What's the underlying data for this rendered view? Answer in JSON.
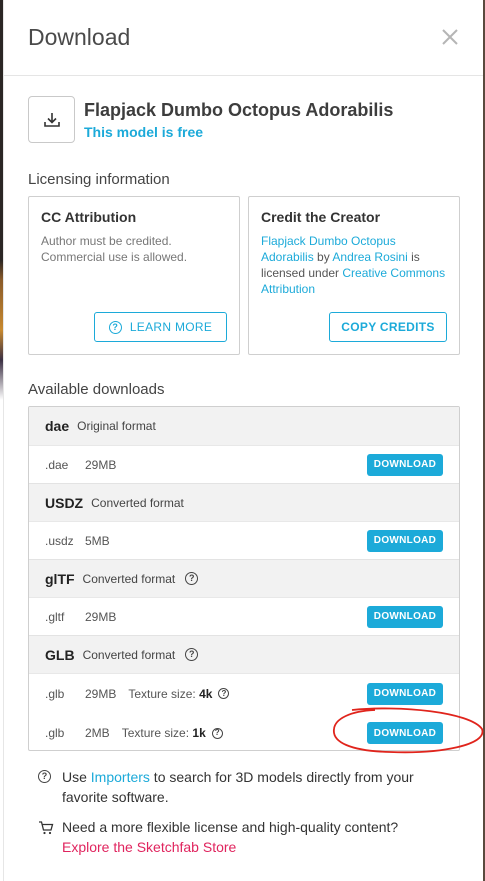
{
  "modal": {
    "title": "Download",
    "close_icon": "close-icon"
  },
  "model": {
    "icon": "download-icon",
    "name": "Flapjack Dumbo Octopus Adorabilis",
    "free_text": "This model is free"
  },
  "licensing": {
    "section_title": "Licensing information",
    "cc": {
      "title": "CC Attribution",
      "line1": "Author must be credited.",
      "line2": "Commercial use is allowed.",
      "button_label": "LEARN MORE"
    },
    "credit": {
      "title": "Credit the Creator",
      "model_link": "Flapjack Dumbo Octopus Adorabilis",
      "by": " by ",
      "author_link": "Andrea Rosini",
      "middle": " is licensed under ",
      "license_link": "Creative Commons Attribution",
      "button_label": "COPY CREDITS"
    }
  },
  "downloads": {
    "section_title": "Available downloads",
    "button_label": "DOWNLOAD",
    "formats": [
      {
        "name": "dae",
        "desc": "Original format",
        "rows": [
          {
            "ext": ".dae",
            "size": "29MB"
          }
        ]
      },
      {
        "name": "USDZ",
        "desc": "Converted format",
        "rows": [
          {
            "ext": ".usdz",
            "size": "5MB"
          }
        ]
      },
      {
        "name": "glTF",
        "desc": "Converted format",
        "rows": [
          {
            "ext": ".gltf",
            "size": "29MB"
          }
        ]
      },
      {
        "name": "GLB",
        "desc": "Converted format",
        "rows": [
          {
            "ext": ".glb",
            "size": "29MB",
            "tex_label": "Texture size:",
            "tex_value": "4k"
          },
          {
            "ext": ".glb",
            "size": "2MB",
            "tex_label": "Texture size:",
            "tex_value": "1k"
          }
        ]
      }
    ]
  },
  "notes": {
    "importers_pre": "Use ",
    "importers_link": "Importers",
    "importers_post": " to search for 3D models directly from your favorite software.",
    "store_text": "Need a more flexible license and high-quality content?",
    "store_link": "Explore the Sketchfab Store"
  },
  "colors": {
    "accent": "#1caad9",
    "store_link": "#e0245e",
    "annotation": "#e0241c"
  }
}
